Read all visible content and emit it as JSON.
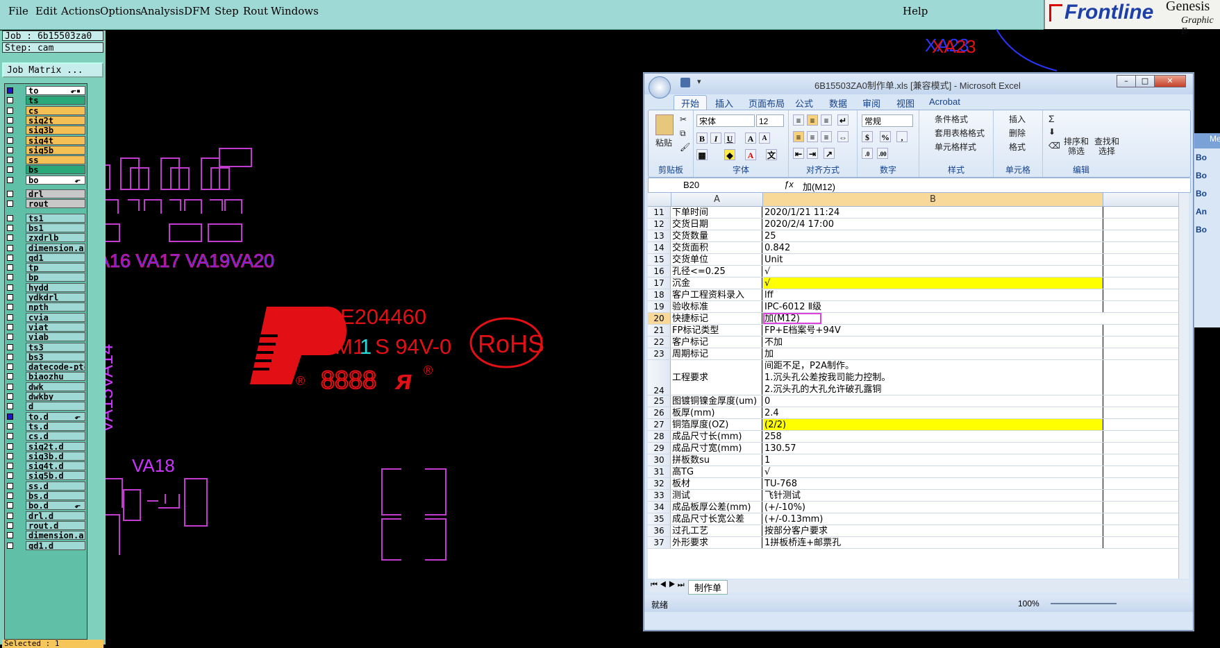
{
  "menubar": {
    "items": [
      "File",
      "Edit",
      "Actions",
      "Options",
      "Analysis",
      "DFM",
      "Step",
      "Rout",
      "Windows"
    ],
    "help": "Help",
    "logo_brand": "Frontline",
    "logo_product": "Genesis",
    "logo_sub": "Graphic E"
  },
  "left_panel": {
    "job": "Job : 6b15503za0",
    "step": "Step: cam",
    "job_matrix": "Job Matrix ...",
    "layers": [
      {
        "name": "to",
        "color": "#ffffff",
        "checked": true,
        "edit": "⬐▪"
      },
      {
        "name": "ts",
        "color": "#2aa879",
        "checked": false,
        "edit": ""
      },
      {
        "name": "cs",
        "color": "#f4bf55",
        "checked": false,
        "edit": ""
      },
      {
        "name": "sig2t",
        "color": "#f4bf55",
        "checked": false,
        "edit": ""
      },
      {
        "name": "sig3b",
        "color": "#f4bf55",
        "checked": false,
        "edit": ""
      },
      {
        "name": "sig4t",
        "color": "#f4bf55",
        "checked": false,
        "edit": ""
      },
      {
        "name": "sig5b",
        "color": "#f4bf55",
        "checked": false,
        "edit": ""
      },
      {
        "name": "ss",
        "color": "#f4bf55",
        "checked": false,
        "edit": ""
      },
      {
        "name": "bs",
        "color": "#2aa879",
        "checked": false,
        "edit": ""
      },
      {
        "name": "bo",
        "color": "#ffffff",
        "checked": false,
        "edit": "⬐"
      },
      {
        "name": "drl",
        "color": "#c8c8c8",
        "checked": false,
        "edit": ""
      },
      {
        "name": "rout",
        "color": "#c8c8c8",
        "checked": false,
        "edit": ""
      },
      {
        "name": "ts1",
        "color": "#9fd9d6",
        "checked": false,
        "edit": ""
      },
      {
        "name": "bs1",
        "color": "#9fd9d6",
        "checked": false,
        "edit": ""
      },
      {
        "name": "zxdrlb",
        "color": "#9fd9d6",
        "checked": false,
        "edit": ""
      },
      {
        "name": "dimension.ar",
        "color": "#9fd9d6",
        "checked": false,
        "edit": ""
      },
      {
        "name": "gd1",
        "color": "#9fd9d6",
        "checked": false,
        "edit": ""
      },
      {
        "name": "tp",
        "color": "#9fd9d6",
        "checked": false,
        "edit": ""
      },
      {
        "name": "bp",
        "color": "#9fd9d6",
        "checked": false,
        "edit": ""
      },
      {
        "name": "hydd",
        "color": "#9fd9d6",
        "checked": false,
        "edit": ""
      },
      {
        "name": "ydkdrl",
        "color": "#9fd9d6",
        "checked": false,
        "edit": ""
      },
      {
        "name": "npth",
        "color": "#9fd9d6",
        "checked": false,
        "edit": ""
      },
      {
        "name": "cvia",
        "color": "#9fd9d6",
        "checked": false,
        "edit": ""
      },
      {
        "name": "viat",
        "color": "#9fd9d6",
        "checked": false,
        "edit": ""
      },
      {
        "name": "viab",
        "color": "#9fd9d6",
        "checked": false,
        "edit": ""
      },
      {
        "name": "ts3",
        "color": "#9fd9d6",
        "checked": false,
        "edit": ""
      },
      {
        "name": "bs3",
        "color": "#9fd9d6",
        "checked": false,
        "edit": ""
      },
      {
        "name": "datecode-ptc",
        "color": "#9fd9d6",
        "checked": false,
        "edit": ""
      },
      {
        "name": "biaozhu",
        "color": "#9fd9d6",
        "checked": false,
        "edit": ""
      },
      {
        "name": "dwk",
        "color": "#9fd9d6",
        "checked": false,
        "edit": ""
      },
      {
        "name": "dwkby",
        "color": "#9fd9d6",
        "checked": false,
        "edit": ""
      },
      {
        "name": "d",
        "color": "#9fd9d6",
        "checked": false,
        "edit": ""
      },
      {
        "name": "to.d",
        "color": "#9fd9d6",
        "checked": true,
        "edit": "⬐"
      },
      {
        "name": "ts.d",
        "color": "#9fd9d6",
        "checked": false,
        "edit": ""
      },
      {
        "name": "cs.d",
        "color": "#9fd9d6",
        "checked": false,
        "edit": ""
      },
      {
        "name": "sig2t.d",
        "color": "#9fd9d6",
        "checked": false,
        "edit": ""
      },
      {
        "name": "sig3b.d",
        "color": "#9fd9d6",
        "checked": false,
        "edit": ""
      },
      {
        "name": "sig4t.d",
        "color": "#9fd9d6",
        "checked": false,
        "edit": ""
      },
      {
        "name": "sig5b.d",
        "color": "#9fd9d6",
        "checked": false,
        "edit": ""
      },
      {
        "name": "ss.d",
        "color": "#9fd9d6",
        "checked": false,
        "edit": ""
      },
      {
        "name": "bs.d",
        "color": "#9fd9d6",
        "checked": false,
        "edit": ""
      },
      {
        "name": "bo.d",
        "color": "#9fd9d6",
        "checked": false,
        "edit": "⬐"
      },
      {
        "name": "drl.d",
        "color": "#9fd9d6",
        "checked": false,
        "edit": ""
      },
      {
        "name": "rout.d",
        "color": "#9fd9d6",
        "checked": false,
        "edit": ""
      },
      {
        "name": "dimension.ar",
        "color": "#9fd9d6",
        "checked": false,
        "edit": ""
      },
      {
        "name": "gd1.d",
        "color": "#9fd9d6",
        "checked": false,
        "edit": ""
      }
    ],
    "selected": "Selected : 1"
  },
  "canvas": {
    "labels_top": "A16 VA17 VA19VA20",
    "vertical_label": "VA15VA14",
    "va18": "VA18",
    "e_number": "E204460",
    "m11_prefix": "M1",
    "m11_suffix": "1",
    "grade": "S 94V-0",
    "rohs": "RoHS",
    "digits": "8888",
    "ul": "ᴙ",
    "reg1": "®",
    "reg2": "®",
    "xa23": "XA23",
    "xa23_2": "XA23"
  },
  "excel": {
    "title": "6B15503ZA0制作单.xls [兼容模式] - Microsoft Excel",
    "tabs": [
      "开始",
      "插入",
      "页面布局",
      "公式",
      "数据",
      "审阅",
      "视图",
      "Acrobat"
    ],
    "ribbon": {
      "paste": "粘贴",
      "font_name": "宋体",
      "font_size": "12",
      "number_format": "常规",
      "cond_format": "条件格式",
      "table_format": "套用表格格式",
      "cell_style": "单元格样式",
      "insert": "插入",
      "delete": "删除",
      "format": "格式",
      "sort_filter": "排序和\n筛选",
      "find_select": "查找和\n选择",
      "groups": [
        "剪贴板",
        "字体",
        "对齐方式",
        "数字",
        "样式",
        "单元格",
        "编辑"
      ]
    },
    "namebox": "B20",
    "formula": "加(M12)",
    "col_a": "A",
    "col_b": "B",
    "rows": [
      {
        "n": "11",
        "a": "下单时间",
        "b": "2020/1/21 11:24",
        "hl": false
      },
      {
        "n": "12",
        "a": "交货日期",
        "b": "2020/2/4 17:00",
        "hl": false
      },
      {
        "n": "13",
        "a": "交货数量",
        "b": "25",
        "hl": false
      },
      {
        "n": "14",
        "a": "交货面积",
        "b": "0.842",
        "hl": false
      },
      {
        "n": "15",
        "a": "交货单位",
        "b": "Unit",
        "hl": false
      },
      {
        "n": "16",
        "a": "孔径<=0.25",
        "b": "√",
        "hl": false
      },
      {
        "n": "17",
        "a": "沉金",
        "b": "√",
        "hl": true
      },
      {
        "n": "18",
        "a": "客户工程资料录入",
        "b": "lff",
        "hl": false
      },
      {
        "n": "19",
        "a": "验收标准",
        "b": "IPC-6012 Ⅱ级",
        "hl": false
      },
      {
        "n": "20",
        "a": "快捷标记",
        "b": "加(M12)",
        "hl": false
      },
      {
        "n": "21",
        "a": "FP标记类型",
        "b": "FP+E档案号+94V",
        "hl": false
      },
      {
        "n": "22",
        "a": "客户标记",
        "b": "不加",
        "hl": false
      },
      {
        "n": "23",
        "a": "周期标记",
        "b": "加",
        "hl": false
      },
      {
        "n": "24",
        "a": "工程要求",
        "b": "间距不足，P2A制作。\n1.沉头孔公差按我司能力控制。\n2.沉头孔的大孔允许破孔露铜",
        "hl": false
      },
      {
        "n": "25",
        "a": "图镀铜镍金厚度(um)",
        "b": "0",
        "hl": false
      },
      {
        "n": "26",
        "a": "板厚(mm)",
        "b": "2.4",
        "hl": false
      },
      {
        "n": "27",
        "a": "铜箔厚度(OZ)",
        "b": "(2/2)",
        "hl": true
      },
      {
        "n": "28",
        "a": "成品尺寸长(mm)",
        "b": "258",
        "hl": false
      },
      {
        "n": "29",
        "a": "成品尺寸宽(mm)",
        "b": "130.57",
        "hl": false
      },
      {
        "n": "30",
        "a": "拼板数su",
        "b": "1",
        "hl": false
      },
      {
        "n": "31",
        "a": "高TG",
        "b": "√",
        "hl": false
      },
      {
        "n": "32",
        "a": "板材",
        "b": "TU-768",
        "hl": false
      },
      {
        "n": "33",
        "a": "测试",
        "b": "飞针测试",
        "hl": false
      },
      {
        "n": "34",
        "a": "成品板厚公差(mm)",
        "b": "(+/-10%)",
        "hl": false
      },
      {
        "n": "35",
        "a": "成品尺寸长宽公差",
        "b": "(+/-0.13mm)",
        "hl": false
      },
      {
        "n": "36",
        "a": "过孔工艺",
        "b": "按部分客户要求",
        "hl": false
      },
      {
        "n": "37",
        "a": "外形要求",
        "b": "1拼板桥连+邮票孔",
        "hl": false
      }
    ],
    "sheet_tab": "制作单",
    "status_left": "就绪",
    "zoom": "100%"
  },
  "side_panel": {
    "items": [
      "Bo",
      "Bo",
      "Bo",
      "An",
      "Bo"
    ],
    "header": "Me"
  }
}
